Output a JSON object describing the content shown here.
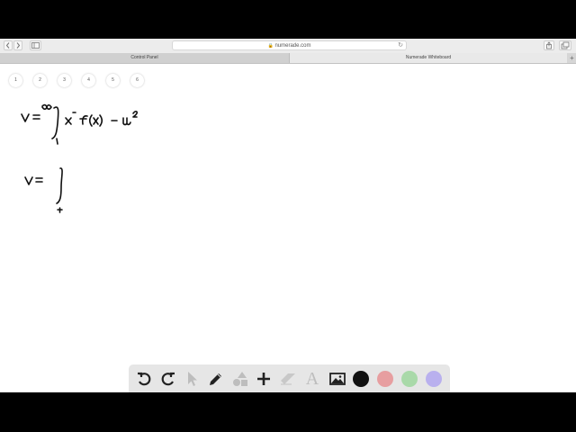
{
  "browser": {
    "url": "numerade.com",
    "tabs": [
      "Control Panel",
      "Numerade Whiteboard"
    ],
    "new_tab_label": "+"
  },
  "pages": [
    "1",
    "2",
    "3",
    "4",
    "5",
    "6"
  ],
  "toolbar": {
    "tools": [
      "undo-icon",
      "redo-icon",
      "select-pointer-icon",
      "pen-icon",
      "shapes-icon",
      "plus-icon",
      "eraser-icon",
      "text-icon",
      "image-icon"
    ],
    "text_tool_glyph": "A",
    "colors": [
      "#111111",
      "#e79ea0",
      "#a9d9a9",
      "#b9b0ee"
    ]
  }
}
